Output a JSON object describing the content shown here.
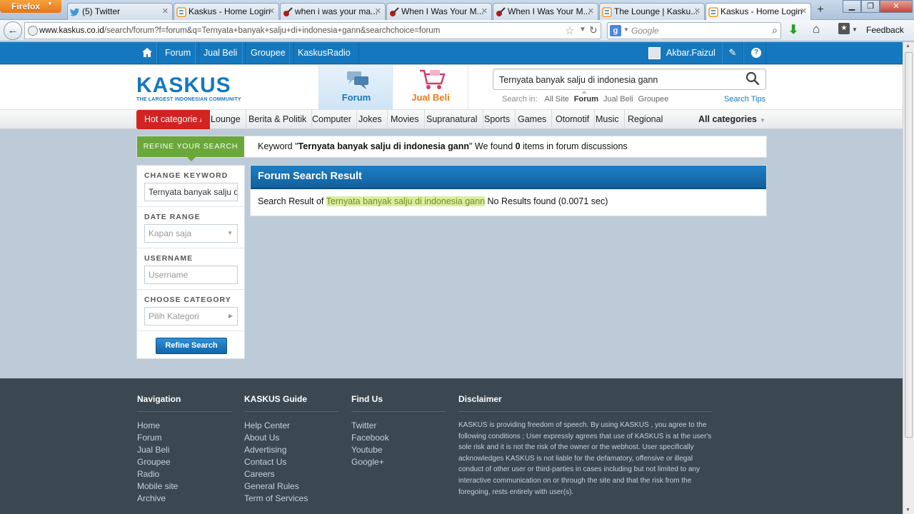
{
  "browser": {
    "app_button": "Firefox",
    "tabs": [
      {
        "title": "(5) Twitter",
        "icon": "twitter-icon"
      },
      {
        "title": "Kaskus - Home Login",
        "icon": "kaskus-favicon"
      },
      {
        "title": "when i was your ma...",
        "icon": "guitar-icon"
      },
      {
        "title": "When I Was Your M...",
        "icon": "guitar-icon"
      },
      {
        "title": "When I Was Your M...",
        "icon": "guitar-icon"
      },
      {
        "title": "The Lounge | Kasku...",
        "icon": "kaskus-favicon"
      },
      {
        "title": "Kaskus - Home Login",
        "icon": "kaskus-favicon",
        "active": true
      }
    ],
    "url_host": "www.kaskus.co.id",
    "url_path": "/search/forum?f=forum&q=Ternyata+banyak+salju+di+indonesia+gann&searchchoice=forum",
    "search_placeholder": "Google",
    "feedback_label": "Feedback"
  },
  "topbar": {
    "links": [
      "Forum",
      "Jual Beli",
      "Groupee",
      "KaskusRadio"
    ],
    "username": "Akbar.Faizul"
  },
  "header": {
    "logo_text": "KASKUS",
    "logo_tagline": "THE LARGEST INDONESIAN COMMUNITY",
    "forum_tab": "Forum",
    "jualbeli_tab": "Jual Beli",
    "search_value": "Ternyata banyak salju di indonesia gann",
    "search_in_label": "Search in:",
    "search_in_options": [
      "All Site",
      "Forum",
      "Jual Beli",
      "Groupee"
    ],
    "search_in_selected": "Forum",
    "search_tips": "Search Tips"
  },
  "categories": {
    "hot_label": "Hot categories",
    "items": [
      "Lounge",
      "Berita & Politik",
      "Computer",
      "Jokes",
      "Movies",
      "Supranatural",
      "Sports",
      "Games",
      "Otomotif",
      "Music",
      "Regional"
    ],
    "all_label": "All categories"
  },
  "refine": {
    "label": "REFINE YOUR SEARCH",
    "summary_prefix": "Keyword \"",
    "keyword": "Ternyata banyak salju di indonesia gann",
    "summary_mid": "\" We found ",
    "count": "0",
    "summary_suffix": " items in forum discussions"
  },
  "sidebar": {
    "change_keyword_label": "CHANGE KEYWORD",
    "keyword_value": "Ternyata banyak salju di indonesia gann",
    "date_range_label": "DATE RANGE",
    "date_range_value": "Kapan saja",
    "username_label": "USERNAME",
    "username_placeholder": "Username",
    "category_label": "CHOOSE CATEGORY",
    "category_placeholder": "Pilih Kategori",
    "button_label": "Refine Search"
  },
  "results": {
    "title": "Forum Search Result",
    "prefix": "Search Result of ",
    "keyword": "Ternyata banyak salju di indonesia gann",
    "suffix": " No Results found (0.0071 sec)"
  },
  "footer": {
    "navigation": {
      "title": "Navigation",
      "links": [
        "Home",
        "Forum",
        "Jual Beli",
        "Groupee",
        "Radio",
        "Mobile site",
        "Archive"
      ]
    },
    "guide": {
      "title": "KASKUS Guide",
      "links": [
        "Help Center",
        "About Us",
        "Advertising",
        "Contact Us",
        "Careers",
        "General Rules",
        "Term of Services"
      ]
    },
    "findus": {
      "title": "Find Us",
      "links": [
        "Twitter",
        "Facebook",
        "Youtube",
        "Google+"
      ]
    },
    "disclaimer": {
      "title": "Disclaimer",
      "text": "KASKUS is providing freedom of speech. By using KASKUS , you agree to the following conditions ; User expressly agrees that use of KASKUS is at the user's sole risk and it is not the risk of the owner or the webhost. User specifically acknowledges KASKUS is not liable for the defamatory, offensive or illegal conduct of other user or third-parties in cases including but not limited to any interactive communication on or through the site and that the risk from the foregoing, rests entirely with user(s)."
    }
  },
  "colors": {
    "kaskus_blue": "#1578be",
    "hot_red": "#d22323",
    "refine_green": "#6aa83a",
    "footer_bg": "#3b4851",
    "highlight": "#d9ef9f"
  }
}
